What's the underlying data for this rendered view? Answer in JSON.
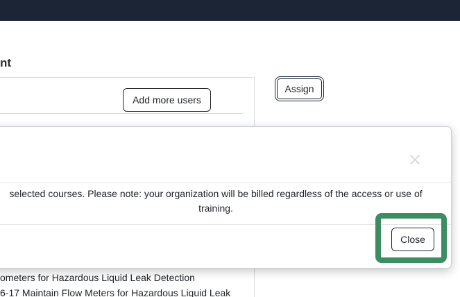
{
  "page": {
    "section_heading_partial": "nt"
  },
  "panel": {
    "add_users_label": "Add more users"
  },
  "assign_label": "Assign",
  "courses": [
    "ometers for Hazardous Liquid Leak Detection",
    "6-17 Maintain Flow Meters for Hazardous Liquid Leak"
  ],
  "modal": {
    "body_line_1": "selected courses. Please note: your organization will be billed regardless of the access or use of",
    "body_line_2": "training.",
    "close_label": "Close",
    "dismiss_icon": "close-icon"
  },
  "colors": {
    "topbar": "#1b2536",
    "highlight": "#3c8d62"
  }
}
